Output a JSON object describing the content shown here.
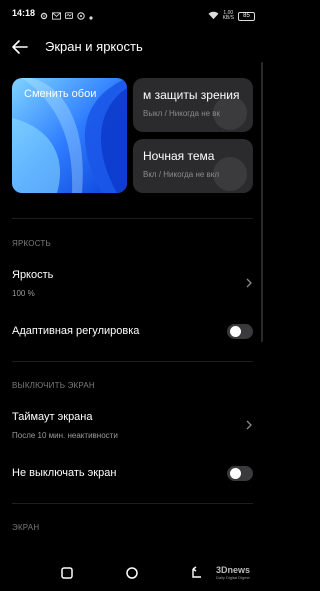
{
  "status_bar": {
    "time": "14:18",
    "icons": [
      "gear-icon",
      "mail-icon",
      "messenger-icon",
      "chat-icon",
      "dot-icon"
    ],
    "net_speed_value": "1,00",
    "net_speed_unit": "KB/S",
    "battery": "85"
  },
  "header": {
    "title": "Экран и яркость"
  },
  "cards": {
    "wallpaper_label": "Сменить обои",
    "eye_protection_title": "м защиты зрения",
    "eye_protection_sub": "Выкл / Никогда не вк",
    "night_mode_title": "Ночная тема",
    "night_mode_sub": "Вкл / Никогда не вкл"
  },
  "sections": {
    "brightness_header": "ЯРКОСТЬ",
    "brightness_title": "Яркость",
    "brightness_value": "100 %",
    "adaptive_label": "Адаптивная регулировка",
    "adaptive_on": false,
    "screen_off_header": "ВЫКЛЮЧИТЬ ЭКРАН",
    "timeout_title": "Таймаут экрана",
    "timeout_value": "После 10 мин. неактивности",
    "keep_on_label": "Не выключать экран",
    "keep_on_enabled": false,
    "screen_header": "ЭКРАН"
  },
  "watermark": {
    "big": "3Dnews",
    "small": "Daily Digital Digest"
  },
  "colors": {
    "background": "#000000",
    "card": "#2b2b2d",
    "toggle_off": "#3a3a3c",
    "wallpaper_blue": "#2f7dff"
  }
}
